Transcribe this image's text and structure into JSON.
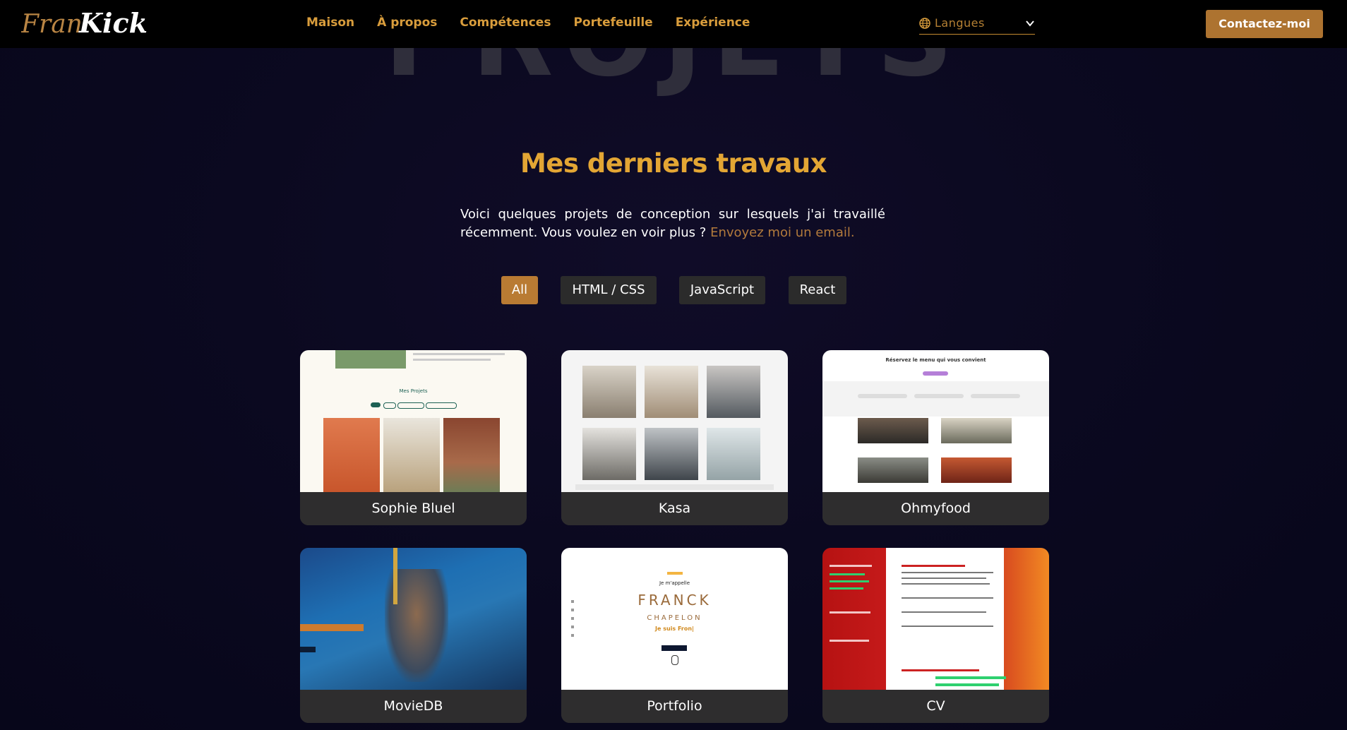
{
  "nav": {
    "logo_alt": "FranKick",
    "links": [
      "Maison",
      "À propos",
      "Compétences",
      "Portefeuille",
      "Expérience"
    ],
    "language_label": "Langues",
    "contact_label": "Contactez-moi"
  },
  "hero": {
    "background_heading": "PROJETS"
  },
  "projects_section": {
    "title": "Mes derniers travaux",
    "intro_text": "Voici quelques projets de conception sur lesquels j'ai travaillé récemment. Vous voulez en voir plus ?",
    "intro_link": "Envoyez moi un email."
  },
  "filters": [
    {
      "label": "All",
      "active": true
    },
    {
      "label": "HTML / CSS",
      "active": false
    },
    {
      "label": "JavaScript",
      "active": false
    },
    {
      "label": "React",
      "active": false
    }
  ],
  "projects": [
    {
      "title": "Sophie Bluel",
      "thumb_caption": "Mes Projets"
    },
    {
      "title": "Kasa"
    },
    {
      "title": "Ohmyfood",
      "thumb_caption": "Réservez le menu qui vous convient"
    },
    {
      "title": "MovieDB"
    },
    {
      "title": "Portfolio",
      "thumb_lines": [
        "Je m'appelle",
        "FRANCK",
        "CHAPELON",
        "Je suis Fron|"
      ]
    },
    {
      "title": "CV"
    }
  ],
  "colors": {
    "accent": "#d99d3c",
    "button_accent": "#ad7330",
    "title": "#e3a634",
    "background": "#0b0920",
    "card": "#2e2d2e"
  }
}
